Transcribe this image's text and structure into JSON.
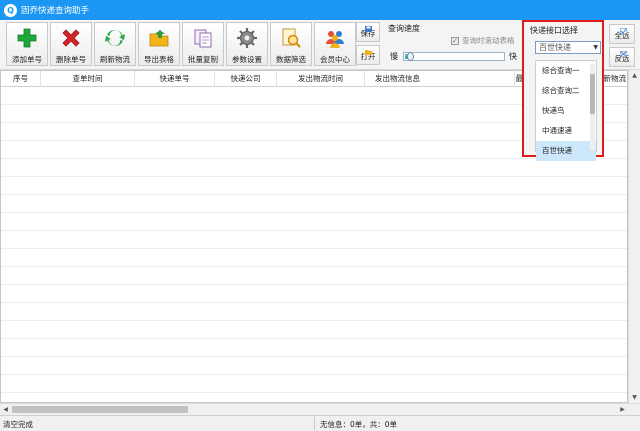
{
  "window": {
    "title": "固乔快递查询助手"
  },
  "toolbar": {
    "buttons": [
      {
        "label": "添加单号",
        "icon": "plus-icon",
        "color": "#1fa83a"
      },
      {
        "label": "删除单号",
        "icon": "delete-x-icon",
        "color": "#d8232a"
      },
      {
        "label": "刷新物流",
        "icon": "refresh-icon",
        "color": "#2fa84f"
      },
      {
        "label": "导出表格",
        "icon": "export-folder-icon",
        "color": "#f2b31a"
      },
      {
        "label": "批量复制",
        "icon": "copy-document-icon",
        "color": "#b58fd0"
      },
      {
        "label": "参数设置",
        "icon": "gear-icon",
        "color": "#7a7a7a"
      },
      {
        "label": "数据筛选",
        "icon": "filter-magnifier-icon",
        "color": "#f0a820"
      },
      {
        "label": "会员中心",
        "icon": "members-icon",
        "color": "#e2503a"
      }
    ],
    "save_label": "保存",
    "open_label": "打开"
  },
  "speed": {
    "title": "查询速度",
    "auto_scroll_label": "查询时滚动表格",
    "auto_scroll_checked": true,
    "slow_label": "慢",
    "fast_label": "快",
    "level_fraction": 0.06
  },
  "courier": {
    "title": "快递接口选择",
    "selected": "百世快递",
    "options": [
      "综合查询一",
      "综合查询二",
      "快递鸟",
      "中通速递",
      "百世快递"
    ],
    "highlighted_index": 4
  },
  "side": {
    "select_all_label": "全选",
    "invert_label": "反选"
  },
  "table": {
    "columns": [
      "序号",
      "查单时间",
      "快递单号",
      "快递公司",
      "发出物流时间",
      "发出物流信息",
      "最后物",
      "最后更新物流"
    ]
  },
  "status": {
    "left": "清空完成",
    "middle": "无信息：0单，共：0单"
  },
  "accent_colors": {
    "titlebar": "#1b96f2",
    "highlight_border": "#e01b1b",
    "slider_fill": "#16a9a0"
  }
}
